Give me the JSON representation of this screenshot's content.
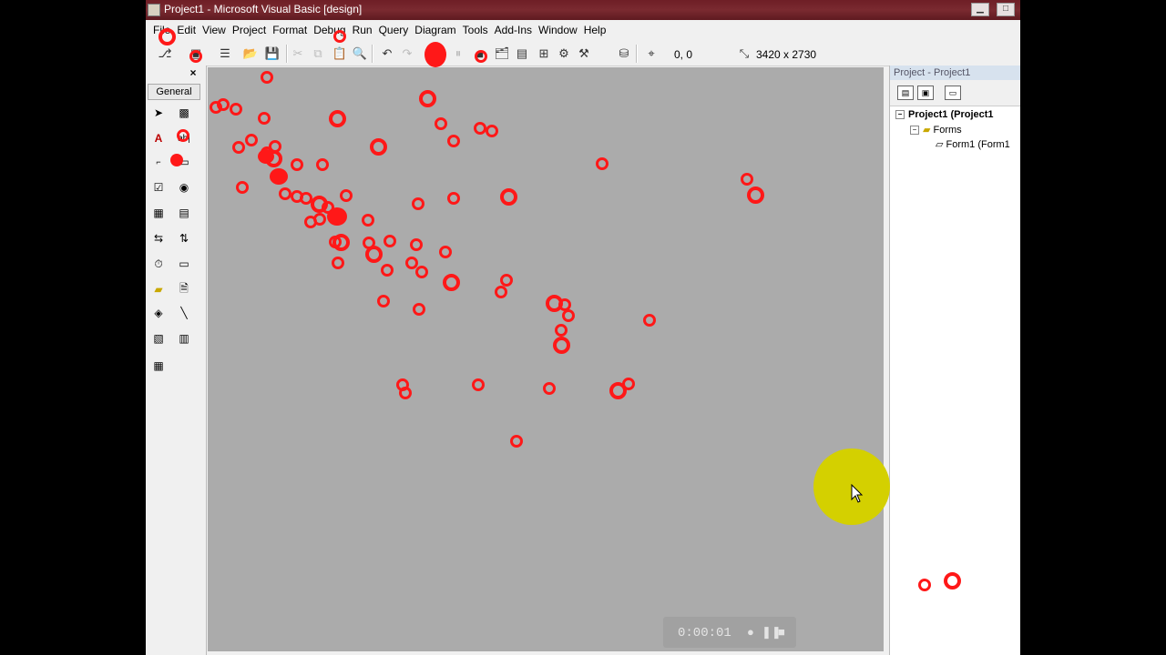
{
  "window": {
    "title": "Project1 - Microsoft Visual Basic [design]",
    "min_label": "▁",
    "max_label": "□",
    "titlebar_color": "#6e1e26"
  },
  "menu": {
    "items": [
      "File",
      "Edit",
      "View",
      "Project",
      "Format",
      "Debug",
      "Run",
      "Query",
      "Diagram",
      "Tools",
      "Add-Ins",
      "Window",
      "Help"
    ]
  },
  "toolbar": {
    "position_readout": "0, 0",
    "size_readout": "3420 x 2730"
  },
  "toolbox": {
    "close_label": "×",
    "tab_label": "General"
  },
  "project_explorer": {
    "title": "Project - Project1",
    "tree": {
      "project_label": "Project1 (Project1",
      "folder_label": "Forms",
      "form_label": "Form1 (Form1"
    }
  },
  "recorder": {
    "elapsed": "0:00:01"
  },
  "colors": {
    "click_marker": "#ff1818",
    "cursor_highlight": "#d4d000",
    "form_background": "#ababab"
  }
}
